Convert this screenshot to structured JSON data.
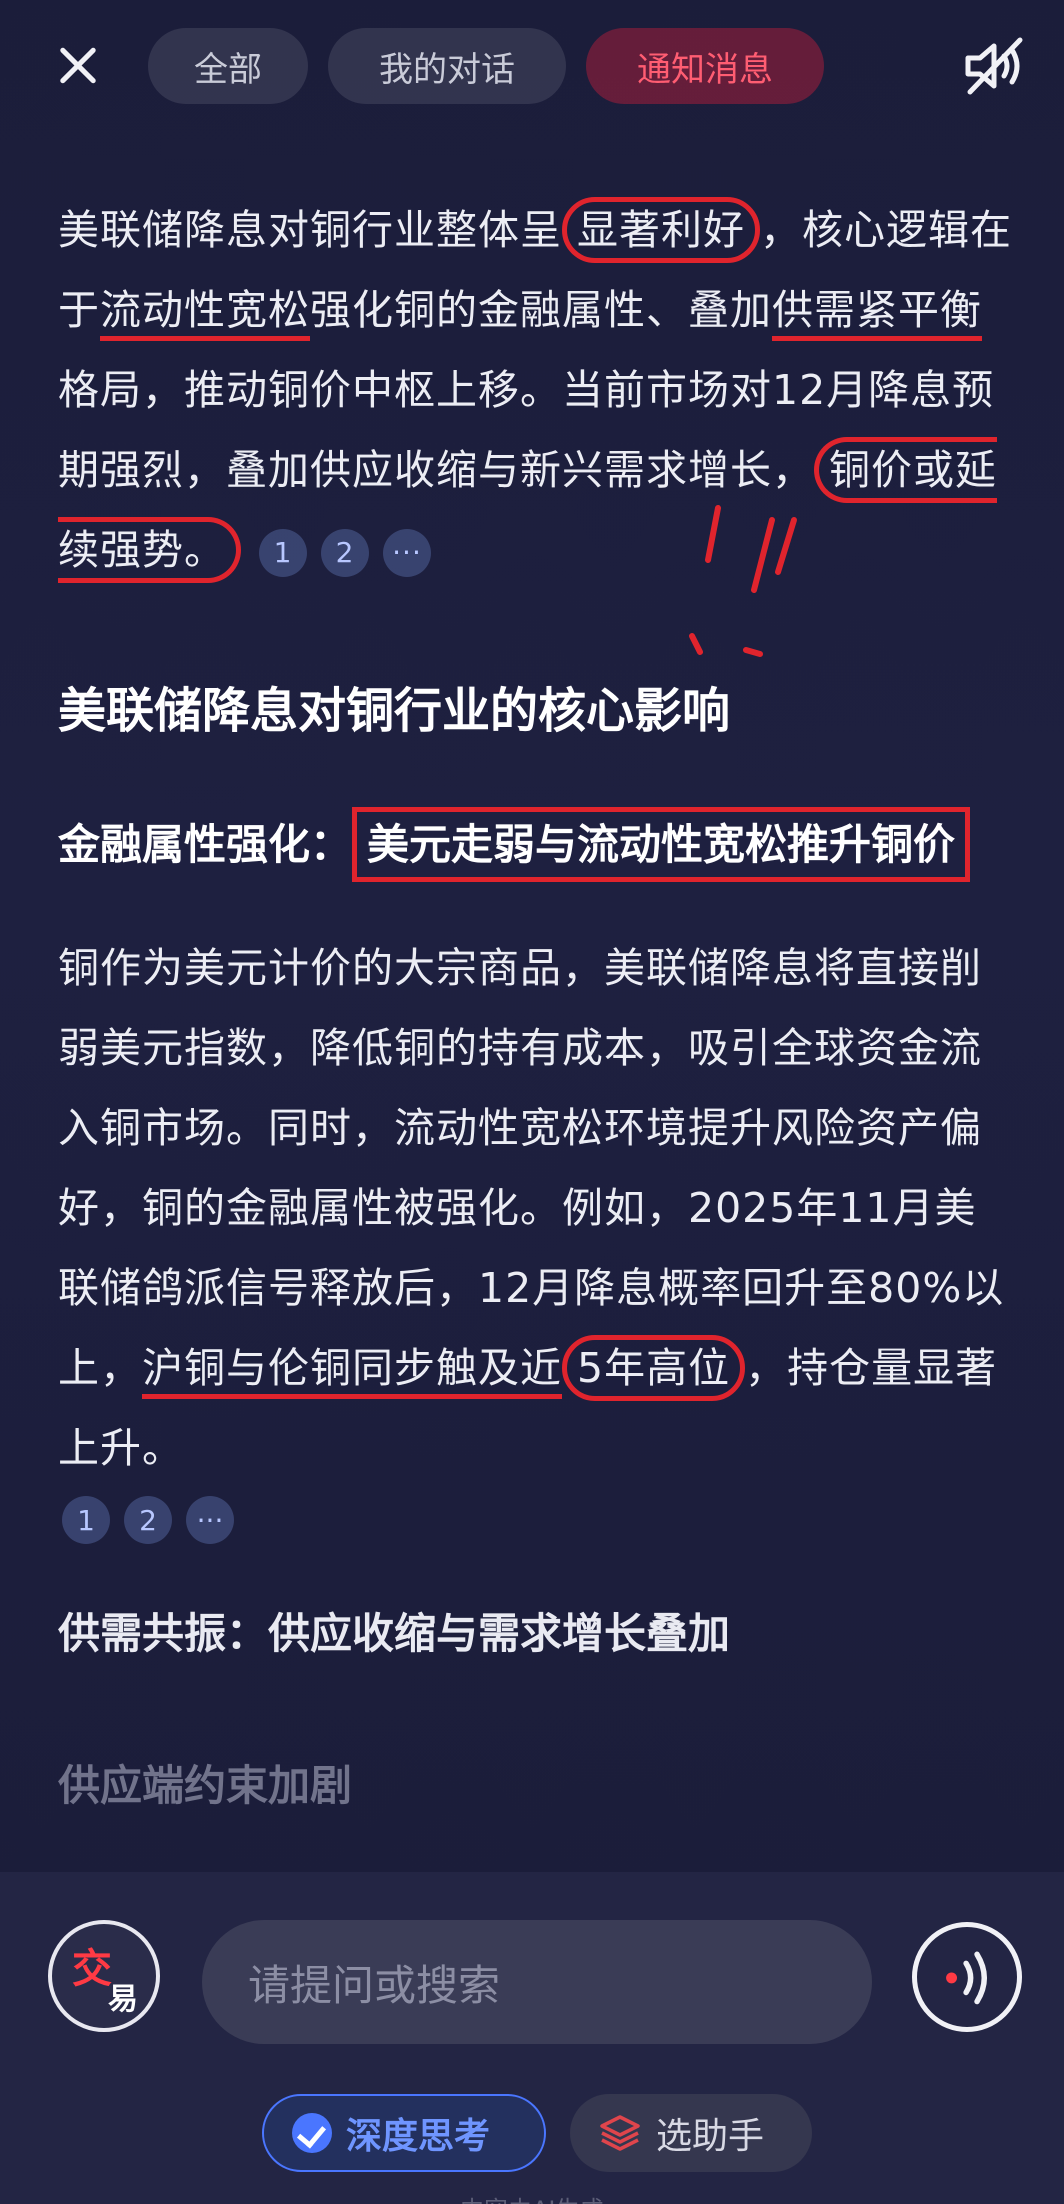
{
  "header": {
    "tabs": [
      {
        "label": "全部"
      },
      {
        "label": "我的对话"
      },
      {
        "label": "通知消息"
      }
    ]
  },
  "content": {
    "intro": {
      "p1": "美联储降息对铜行业整体呈",
      "p2": "显著利好",
      "p3": "，核心逻辑在于",
      "p4": "流动性宽松",
      "p5": "强化铜的金融属性、叠加",
      "p6": "供需紧平衡",
      "p7": "格局，推动铜价中枢上移。当前市场对12月降息预期强烈，叠加供应收缩与新兴需求增长，",
      "p8": "铜价或延续强势。",
      "cites": [
        "1",
        "2",
        "···"
      ]
    },
    "heading": "美联储降息对铜行业的核心影响",
    "section1": {
      "label": "金融属性强化：",
      "title": "美元走弱与流动性宽松推升铜价"
    },
    "body": {
      "p1": "铜作为美元计价的大宗商品，美联储降息将直接削弱美元指数，降低铜的持有成本，吸引全球资金流入铜市场。同时，流动性宽松环境提升风险资产偏好，铜的金融属性被强化。例如，2025年11月美联储鸽派信号释放后，12月降息概率回升至80%以上，",
      "p2": "沪铜与伦铜同步触及近",
      "p3": "5年高位",
      "p4": "，持仓量显著上升。",
      "cites": [
        "1",
        "2",
        "···"
      ]
    },
    "section2": "供需共振：供应收缩与需求增长叠加",
    "section3": "供应端约束加剧"
  },
  "bottom": {
    "logo_top": "交",
    "logo_bottom": "易",
    "search_placeholder": "请提问或搜索",
    "deep_think": "深度思考",
    "helper": "选助手",
    "footer": "内容由AI生成"
  },
  "colors": {
    "accent_red": "#e0242d",
    "active_tab": "#ff5d72",
    "blue": "#4a76ff"
  }
}
